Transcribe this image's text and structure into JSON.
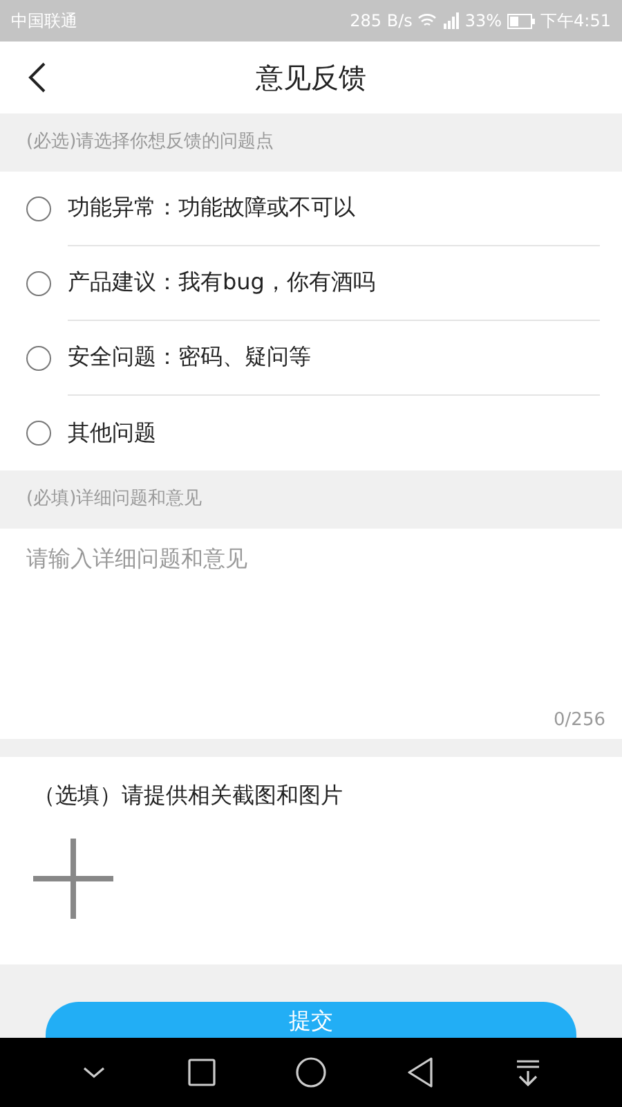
{
  "status_bar": {
    "carrier": "中国联通",
    "speed": "285 B/s",
    "battery": "33%",
    "time": "下午4:51"
  },
  "header": {
    "title": "意见反馈"
  },
  "issue_section": {
    "label": "(必选)请选择你想反馈的问题点",
    "options": [
      {
        "label": "功能异常：功能故障或不可以",
        "selected": false
      },
      {
        "label": "产品建议：我有bug，你有酒吗",
        "selected": false
      },
      {
        "label": "安全问题：密码、疑问等",
        "selected": false
      },
      {
        "label": "其他问题",
        "selected": false
      }
    ]
  },
  "detail_section": {
    "label": "(必填)详细问题和意见",
    "placeholder": "请输入详细问题和意见",
    "counter": "0/256"
  },
  "image_section": {
    "label": "（选填）请提供相关截图和图片"
  },
  "submit_button": "提交"
}
